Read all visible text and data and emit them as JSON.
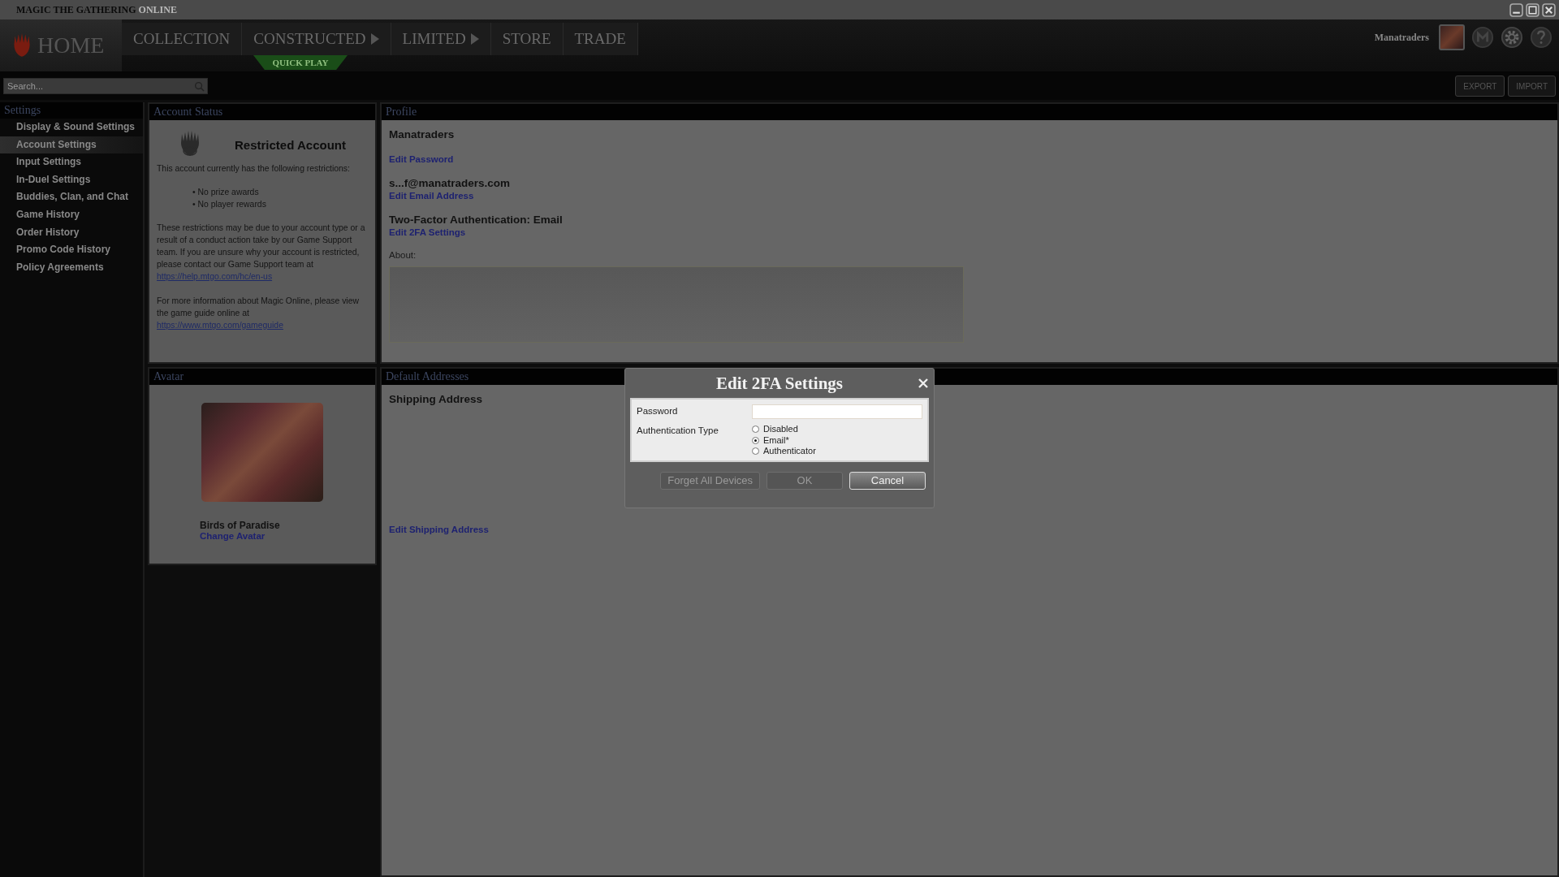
{
  "window": {
    "title_main": "MAGIC THE GATHERING",
    "title_suffix": "ONLINE"
  },
  "nav": {
    "home": {
      "label": "HOME",
      "selected": true
    },
    "items": [
      {
        "label": "COLLECTION",
        "arrow": false,
        "selected": false
      },
      {
        "label": "CONSTRUCTED",
        "arrow": true,
        "selected": false
      },
      {
        "label": "LIMITED",
        "arrow": true,
        "selected": false
      },
      {
        "label": "STORE",
        "arrow": false,
        "selected": false
      },
      {
        "label": "TRADE",
        "arrow": false,
        "selected": false
      }
    ],
    "quick_play": "QUICK PLAY",
    "user_name": "Manatraders"
  },
  "search": {
    "placeholder": "Search..."
  },
  "toolbar_buttons": [
    "EXPORT",
    "IMPORT"
  ],
  "sidebar": {
    "title": "Settings",
    "items": [
      {
        "label": "Display & Sound Settings",
        "selected": false
      },
      {
        "label": "Account Settings",
        "selected": true
      },
      {
        "label": "Input Settings",
        "selected": false
      },
      {
        "label": "In-Duel Settings",
        "selected": false
      },
      {
        "label": "Buddies, Clan, and Chat",
        "selected": false
      },
      {
        "label": "Game History",
        "selected": false
      },
      {
        "label": "Order History",
        "selected": false
      },
      {
        "label": "Promo Code History",
        "selected": false
      },
      {
        "label": "Policy Agreements",
        "selected": false
      }
    ]
  },
  "account_status": {
    "title": "Account Status",
    "heading": "Restricted Account",
    "intro": "This account currently has the following restrictions:",
    "restrictions": [
      "• No prize awards",
      "• No player rewards"
    ],
    "note": "These restrictions may be due to your account type or a result of a conduct action take by our Game Support team.  If you are unsure why your account is restricted, please contact our Game Support team at",
    "note_link": "https://help.mtgo.com/hc/en-us",
    "guide": "For more information about Magic Online, please view the game guide online at",
    "guide_link": "https://www.mtgo.com/gameguide"
  },
  "avatar": {
    "title": "Avatar",
    "card_name": "Birds of Paradise",
    "change_link": "Change Avatar"
  },
  "profile": {
    "title": "Profile",
    "username": "Manatraders",
    "edit_password": "Edit Password",
    "email": "s...f@manatraders.com",
    "edit_email": "Edit Email Address",
    "two_factor": "Two-Factor Authentication: Email",
    "edit_2fa": "Edit 2FA Settings",
    "about_label": "About:"
  },
  "addresses": {
    "title": "Default Addresses",
    "shipping_heading": "Shipping Address",
    "edit_shipping": "Edit Shipping Address"
  },
  "dialog": {
    "title": "Edit 2FA Settings",
    "password_label": "Password",
    "auth_label": "Authentication Type",
    "auth_options": [
      {
        "label": "Disabled",
        "selected": false
      },
      {
        "label": "Email*",
        "selected": true
      },
      {
        "label": "Authenticator",
        "selected": false
      }
    ],
    "buttons": [
      {
        "label": "Forget All Devices",
        "disabled": true
      },
      {
        "label": "OK",
        "disabled": true
      },
      {
        "label": "Cancel",
        "disabled": false
      }
    ]
  }
}
